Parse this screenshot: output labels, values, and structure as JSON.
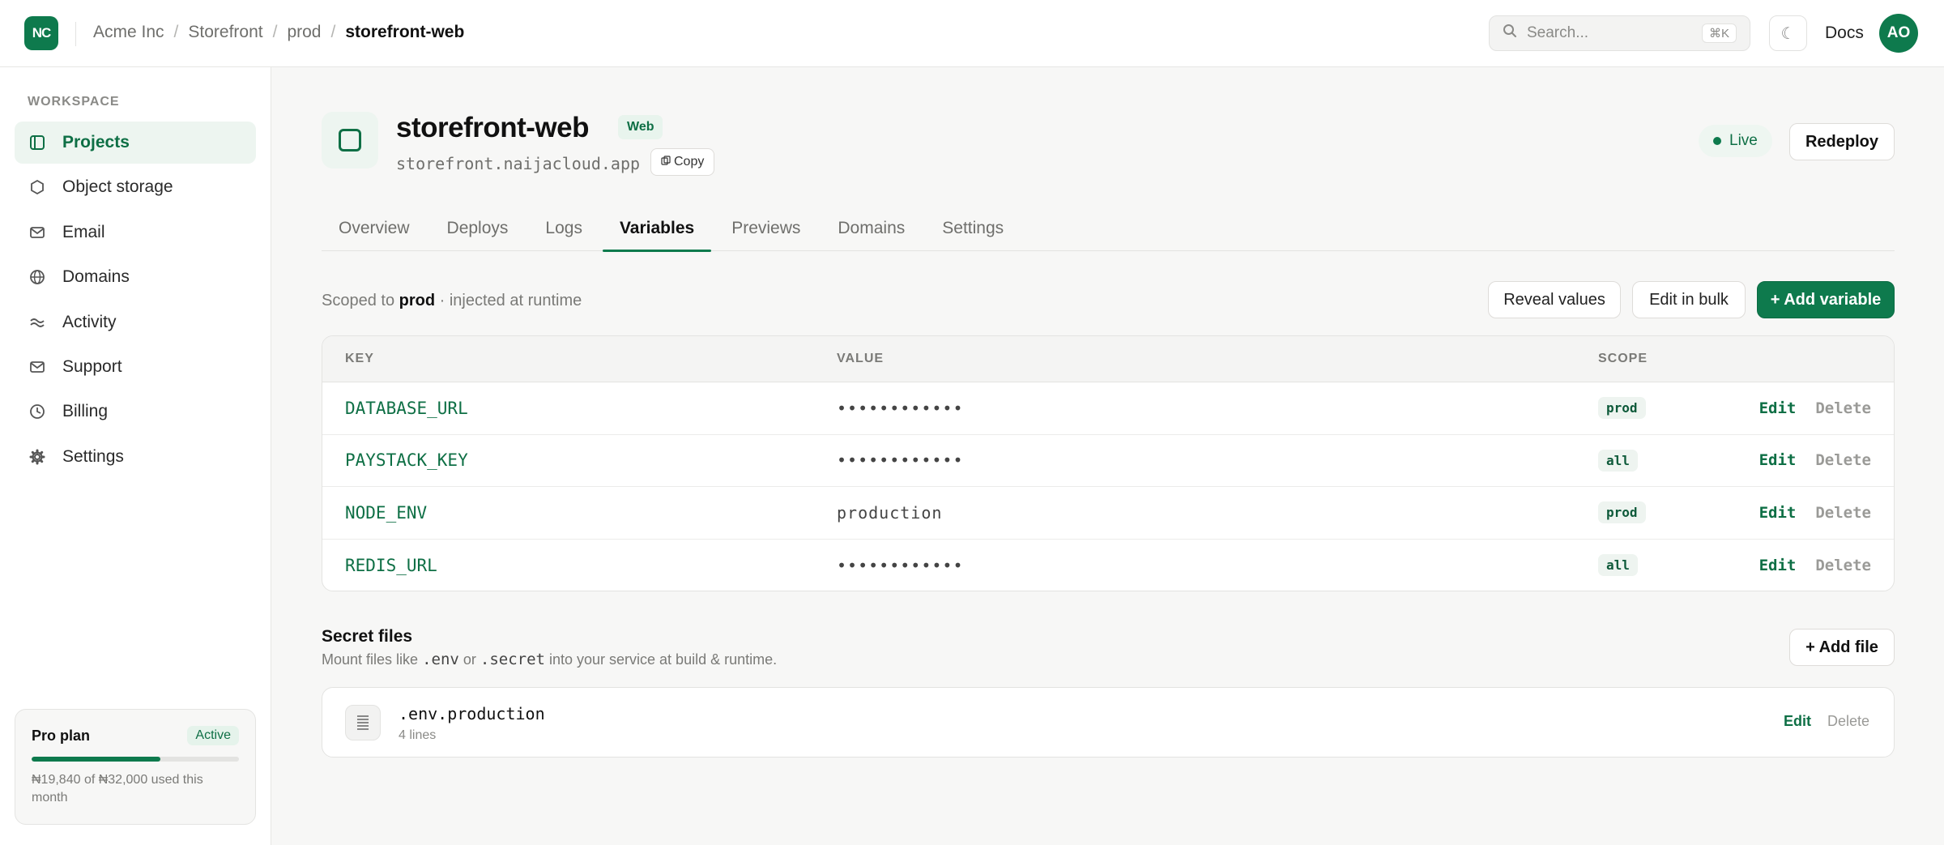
{
  "topbar": {
    "logo_text": "NC",
    "breadcrumb": [
      "Acme Inc",
      "Storefront",
      "prod",
      "storefront-web"
    ],
    "breadcrumb_sep": "/",
    "search_placeholder": "Search...",
    "search_shortcut": "⌘K",
    "theme_icon": "☾",
    "docs_label": "Docs",
    "avatar_initials": "AO"
  },
  "sidebar": {
    "section_label": "WORKSPACE",
    "items": [
      {
        "label": "Projects",
        "icon": "projects-icon",
        "active": true
      },
      {
        "label": "Object storage",
        "icon": "hexagon-icon",
        "active": false
      },
      {
        "label": "Email",
        "icon": "mail-icon",
        "active": false
      },
      {
        "label": "Domains",
        "icon": "globe-icon",
        "active": false
      },
      {
        "label": "Activity",
        "icon": "activity-icon",
        "active": false
      },
      {
        "label": "Support",
        "icon": "support-icon",
        "active": false
      },
      {
        "label": "Billing",
        "icon": "clock-icon",
        "active": false
      },
      {
        "label": "Settings",
        "icon": "gear-icon",
        "active": false
      }
    ],
    "plan": {
      "name": "Pro plan",
      "status": "Active",
      "usage_text": "₦19,840 of ₦32,000 used this month",
      "usage_fraction": 0.62
    }
  },
  "project": {
    "title": "storefront-web",
    "tag": "Web",
    "url": "storefront.naijacloud.app",
    "copy_label": "Copy",
    "live_label": "Live",
    "redeploy_label": "Redeploy"
  },
  "tabs": [
    "Overview",
    "Deploys",
    "Logs",
    "Variables",
    "Previews",
    "Domains",
    "Settings"
  ],
  "active_tab": "Variables",
  "variables": {
    "scope_prefix": "Scoped to",
    "scope_env": "prod",
    "scope_suffix": "· injected at runtime",
    "reveal_label": "Reveal values",
    "bulk_label": "Edit in bulk",
    "add_label": "+ Add variable",
    "columns": {
      "key": "KEY",
      "value": "VALUE",
      "scope": "SCOPE"
    },
    "rows": [
      {
        "key": "DATABASE_URL",
        "value": "••••••••••••",
        "scope": "prod"
      },
      {
        "key": "PAYSTACK_KEY",
        "value": "••••••••••••",
        "scope": "all"
      },
      {
        "key": "NODE_ENV",
        "value": "production",
        "scope": "prod"
      },
      {
        "key": "REDIS_URL",
        "value": "••••••••••••",
        "scope": "all"
      }
    ],
    "edit_label": "Edit",
    "delete_label": "Delete"
  },
  "secret_files": {
    "title": "Secret files",
    "sub_prefix": "Mount files like",
    "sub_env": ".env",
    "sub_or": "or",
    "sub_secret": ".secret",
    "sub_suffix": "into your service at build & runtime.",
    "add_label": "+ Add file",
    "files": [
      {
        "name": ".env.production",
        "meta": "4 lines"
      }
    ],
    "edit_label": "Edit",
    "delete_label": "Delete"
  },
  "colors": {
    "accent": "#0e7a4d",
    "accent_text": "#0e6f45",
    "background": "#f7f7f6"
  }
}
